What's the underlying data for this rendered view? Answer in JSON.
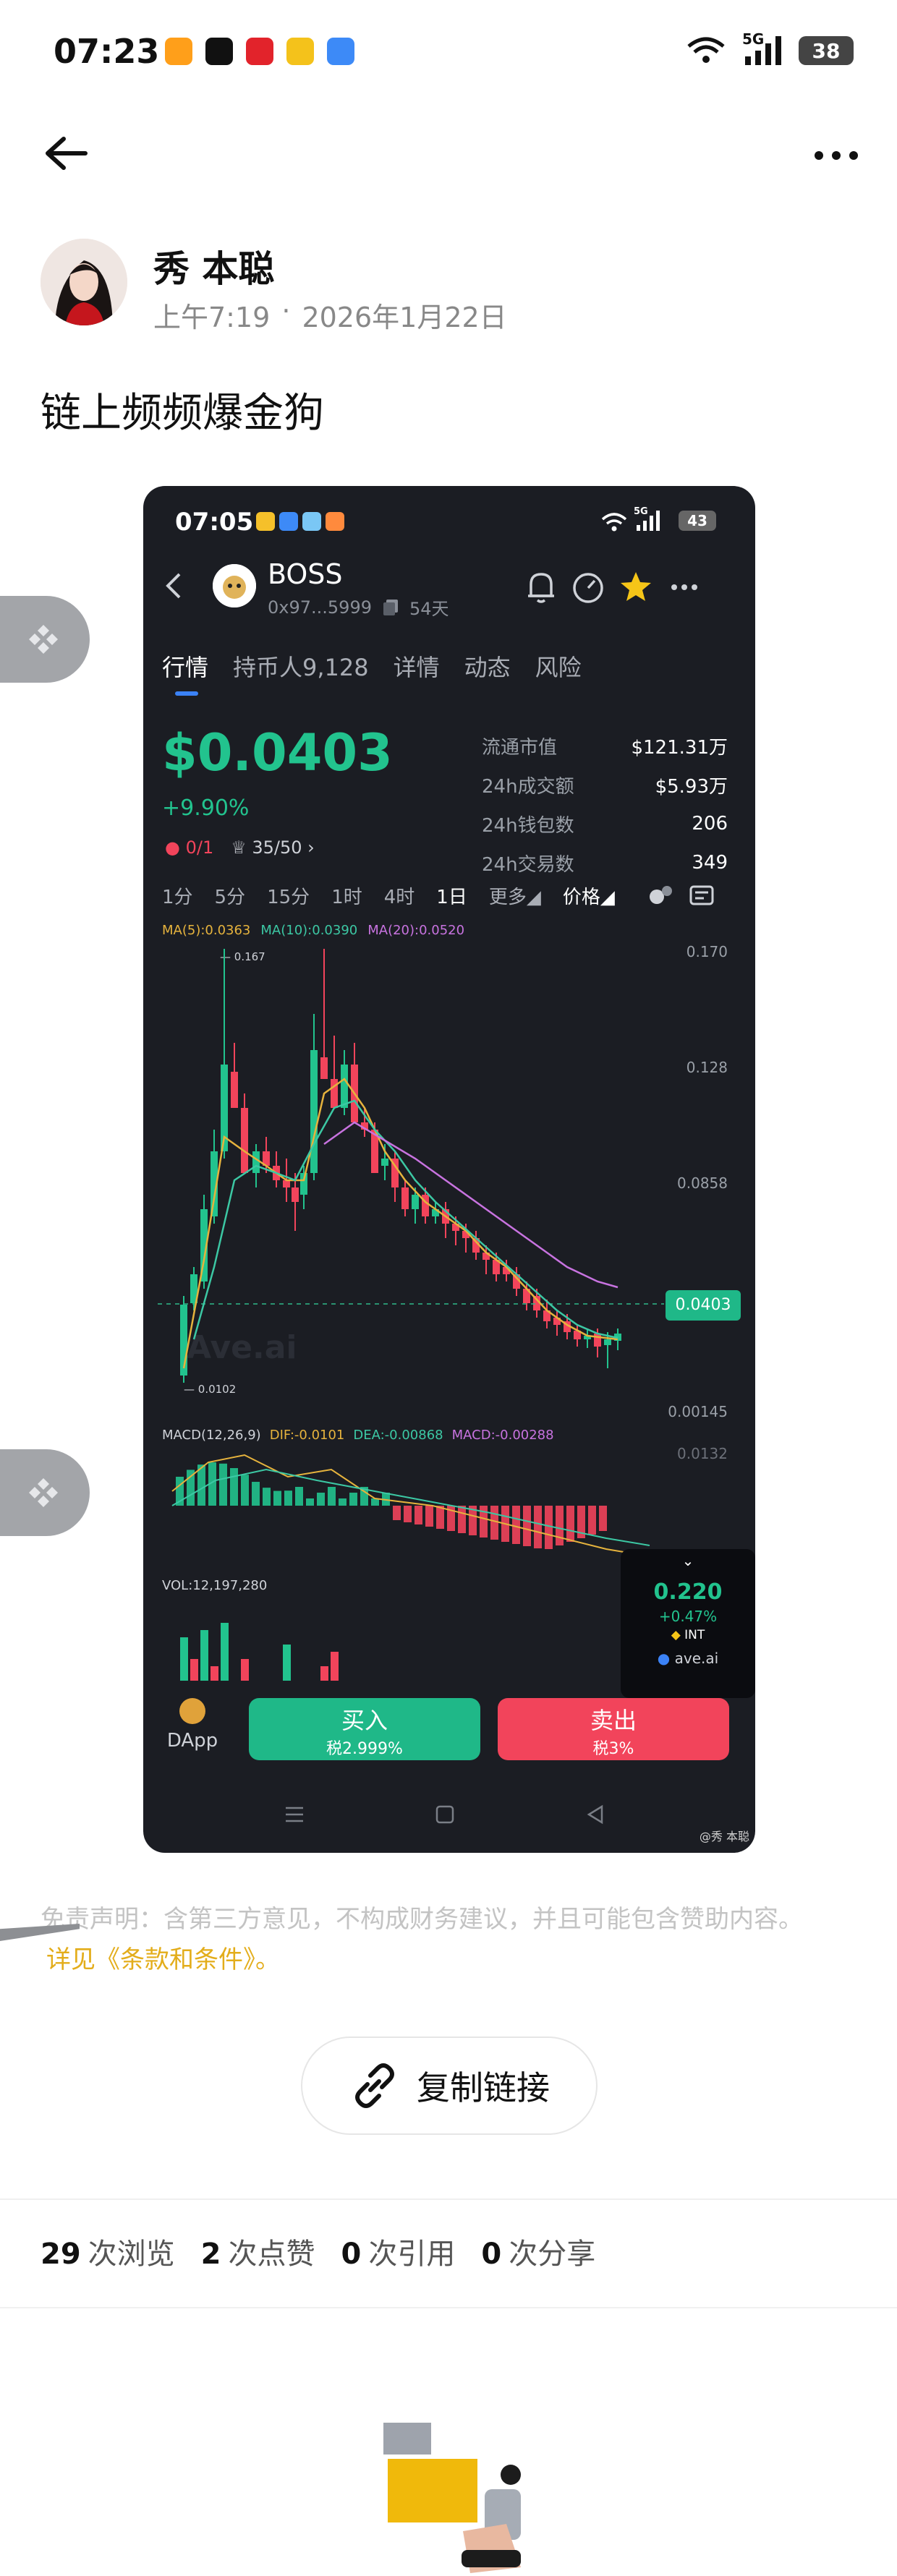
{
  "status_bar": {
    "time": "07:23",
    "network": "5G",
    "battery": "38"
  },
  "post": {
    "author": "秀 本聪",
    "time": "上午7:19",
    "dot": "·",
    "date": "2026年1月22日",
    "title": "链上频频爆金狗"
  },
  "screenshot": {
    "status_time": "07:05",
    "status_network": "5G",
    "status_battery": "43",
    "token": {
      "name": "BOSS",
      "address": "0x97...5999",
      "age": "54天"
    },
    "tabs": [
      "行情",
      "持币人9,128",
      "详情",
      "动态",
      "风险"
    ],
    "price": "$0.0403",
    "change": "+9.90%",
    "badge_1": "0/1",
    "badge_2": "35/50",
    "stats": [
      {
        "label": "流通市值",
        "value": "$121.31万"
      },
      {
        "label": "24h成交额",
        "value": "$5.93万"
      },
      {
        "label": "24h钱包数",
        "value": "206"
      },
      {
        "label": "24h交易数",
        "value": "349"
      }
    ],
    "timeframes": [
      "1分",
      "5分",
      "15分",
      "1时",
      "4时",
      "1日",
      "更多",
      "价格"
    ],
    "ma_legend": [
      {
        "text": "MA(5):0.0363",
        "color": "#e6b33d"
      },
      {
        "text": "MA(10):0.0390",
        "color": "#3cc8a4"
      },
      {
        "text": "MA(20):0.0520",
        "color": "#c873e0"
      }
    ],
    "y_axis": [
      "0.170",
      "0.128",
      "0.0858",
      "0.00145"
    ],
    "high_label": "0.167",
    "low_label": "0.0102",
    "current_price_tag": "0.0403",
    "watermark": "Ave.ai",
    "macd_legend": [
      {
        "text": "MACD(12,26,9)",
        "color": "#cfd2d8"
      },
      {
        "text": "DIF:-0.0101",
        "color": "#e6b33d"
      },
      {
        "text": "DEA:-0.00868",
        "color": "#3cc8a4"
      },
      {
        "text": "MACD:-0.00288",
        "color": "#c873e0"
      }
    ],
    "macd_axis": "0.0132",
    "vol_legend": "VOL:12,197,280",
    "popup": {
      "price": "0.220",
      "change": "+0.47%",
      "symbol": "INT",
      "site": "ave.ai"
    },
    "dapp_label": "DApp",
    "buy_label": "买入",
    "buy_tax": "税2.999%",
    "sell_label": "卖出",
    "sell_tax": "税3%",
    "corner_mark": "@秀 本聪"
  },
  "disclaimer": {
    "line1": "免责声明：含第三方意见，不构成财务建议，并且可能包含赞助内容。",
    "line2": "详见《条款和条件》。"
  },
  "copy_link_label": "复制链接",
  "counts": [
    {
      "num": "29",
      "label": "次浏览"
    },
    {
      "num": "2",
      "label": "次点赞"
    },
    {
      "num": "0",
      "label": "次引用"
    },
    {
      "num": "0",
      "label": "次分享"
    }
  ],
  "colors": {
    "up": "#22c38e",
    "down": "#f2445b",
    "accent": "#e3ad1b",
    "screenshot_bg": "#1b1d23"
  }
}
